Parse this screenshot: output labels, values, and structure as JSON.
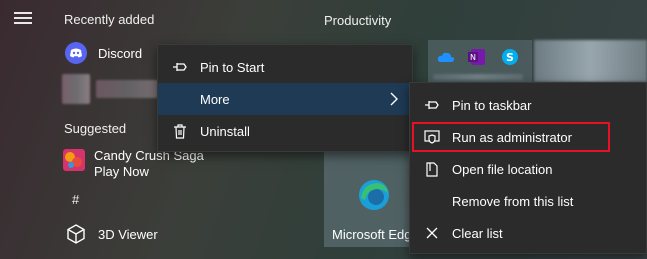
{
  "start_menu": {
    "recently_added_header": "Recently added",
    "productivity_header": "Productivity",
    "suggested_header": "Suggested",
    "hash_header": "#",
    "apps": {
      "discord": "Discord",
      "candy_line1": "Candy Crush Saga",
      "candy_line2": "Play Now",
      "viewer_3d": "3D Viewer"
    },
    "tiles": {
      "edge": "Microsoft Edge"
    }
  },
  "context_menu": {
    "items": [
      {
        "label": "Pin to Start",
        "icon": "pin-icon"
      },
      {
        "label": "More",
        "icon": "chevron-right-icon"
      },
      {
        "label": "Uninstall",
        "icon": "trash-icon"
      }
    ]
  },
  "submenu": {
    "items": [
      {
        "label": "Pin to taskbar",
        "icon": "pin-icon"
      },
      {
        "label": "Run as administrator",
        "icon": "shield-icon"
      },
      {
        "label": "Open file location",
        "icon": "file-location-icon"
      },
      {
        "label": "Remove from this list",
        "icon": ""
      },
      {
        "label": "Clear list",
        "icon": "close-icon"
      }
    ]
  },
  "colors": {
    "menu_bg": "#2b2b2b",
    "hover_bg": "#1e3a55",
    "highlight_border": "#e81123",
    "discord": "#5865f2",
    "edge": "#1aa0d8"
  }
}
